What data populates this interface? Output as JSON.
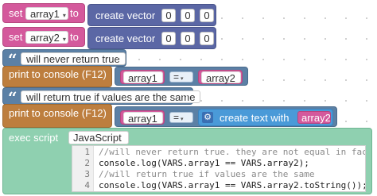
{
  "blocks": {
    "set1": {
      "set_label": "set",
      "var": "array1",
      "to_label": "to",
      "vector_label": "create vector",
      "values": [
        "0",
        "0",
        "0"
      ]
    },
    "set2": {
      "set_label": "set",
      "var": "array2",
      "to_label": "to",
      "vector_label": "create vector",
      "values": [
        "0",
        "0",
        "0"
      ]
    },
    "comment1": {
      "text": "will never return true"
    },
    "print1": {
      "label": "print to console (F12)",
      "left": "array1",
      "op": "=",
      "right": "array2"
    },
    "comment2": {
      "text": "will return true if values are the same"
    },
    "print2": {
      "label": "print to console (F12)",
      "left": "array1",
      "op": "=",
      "text_label": "create text with",
      "right": "array2"
    },
    "exec": {
      "label": "exec script",
      "language": "JavaScript"
    }
  },
  "code_editor": {
    "lines": [
      {
        "num": "1",
        "text": "//will never return true. they are not equal in fact"
      },
      {
        "num": "2",
        "text": "console.log(VARS.array1 == VARS.array2);"
      },
      {
        "num": "3",
        "text": "//will return true if values are the same"
      },
      {
        "num": "4",
        "text": "console.log(VARS.array1 == VARS.array2.toString());"
      }
    ]
  },
  "icons": {
    "quote": "quote-icon",
    "gear": "gear-icon",
    "dropdown": "chevron-down-icon"
  },
  "colors": {
    "variable": "#d4599c",
    "vector": "#5b67a5",
    "print": "#bd7e3e",
    "comment": "#5b80a5",
    "text": "#4a9ad8",
    "exec": "#7fc7a4"
  }
}
